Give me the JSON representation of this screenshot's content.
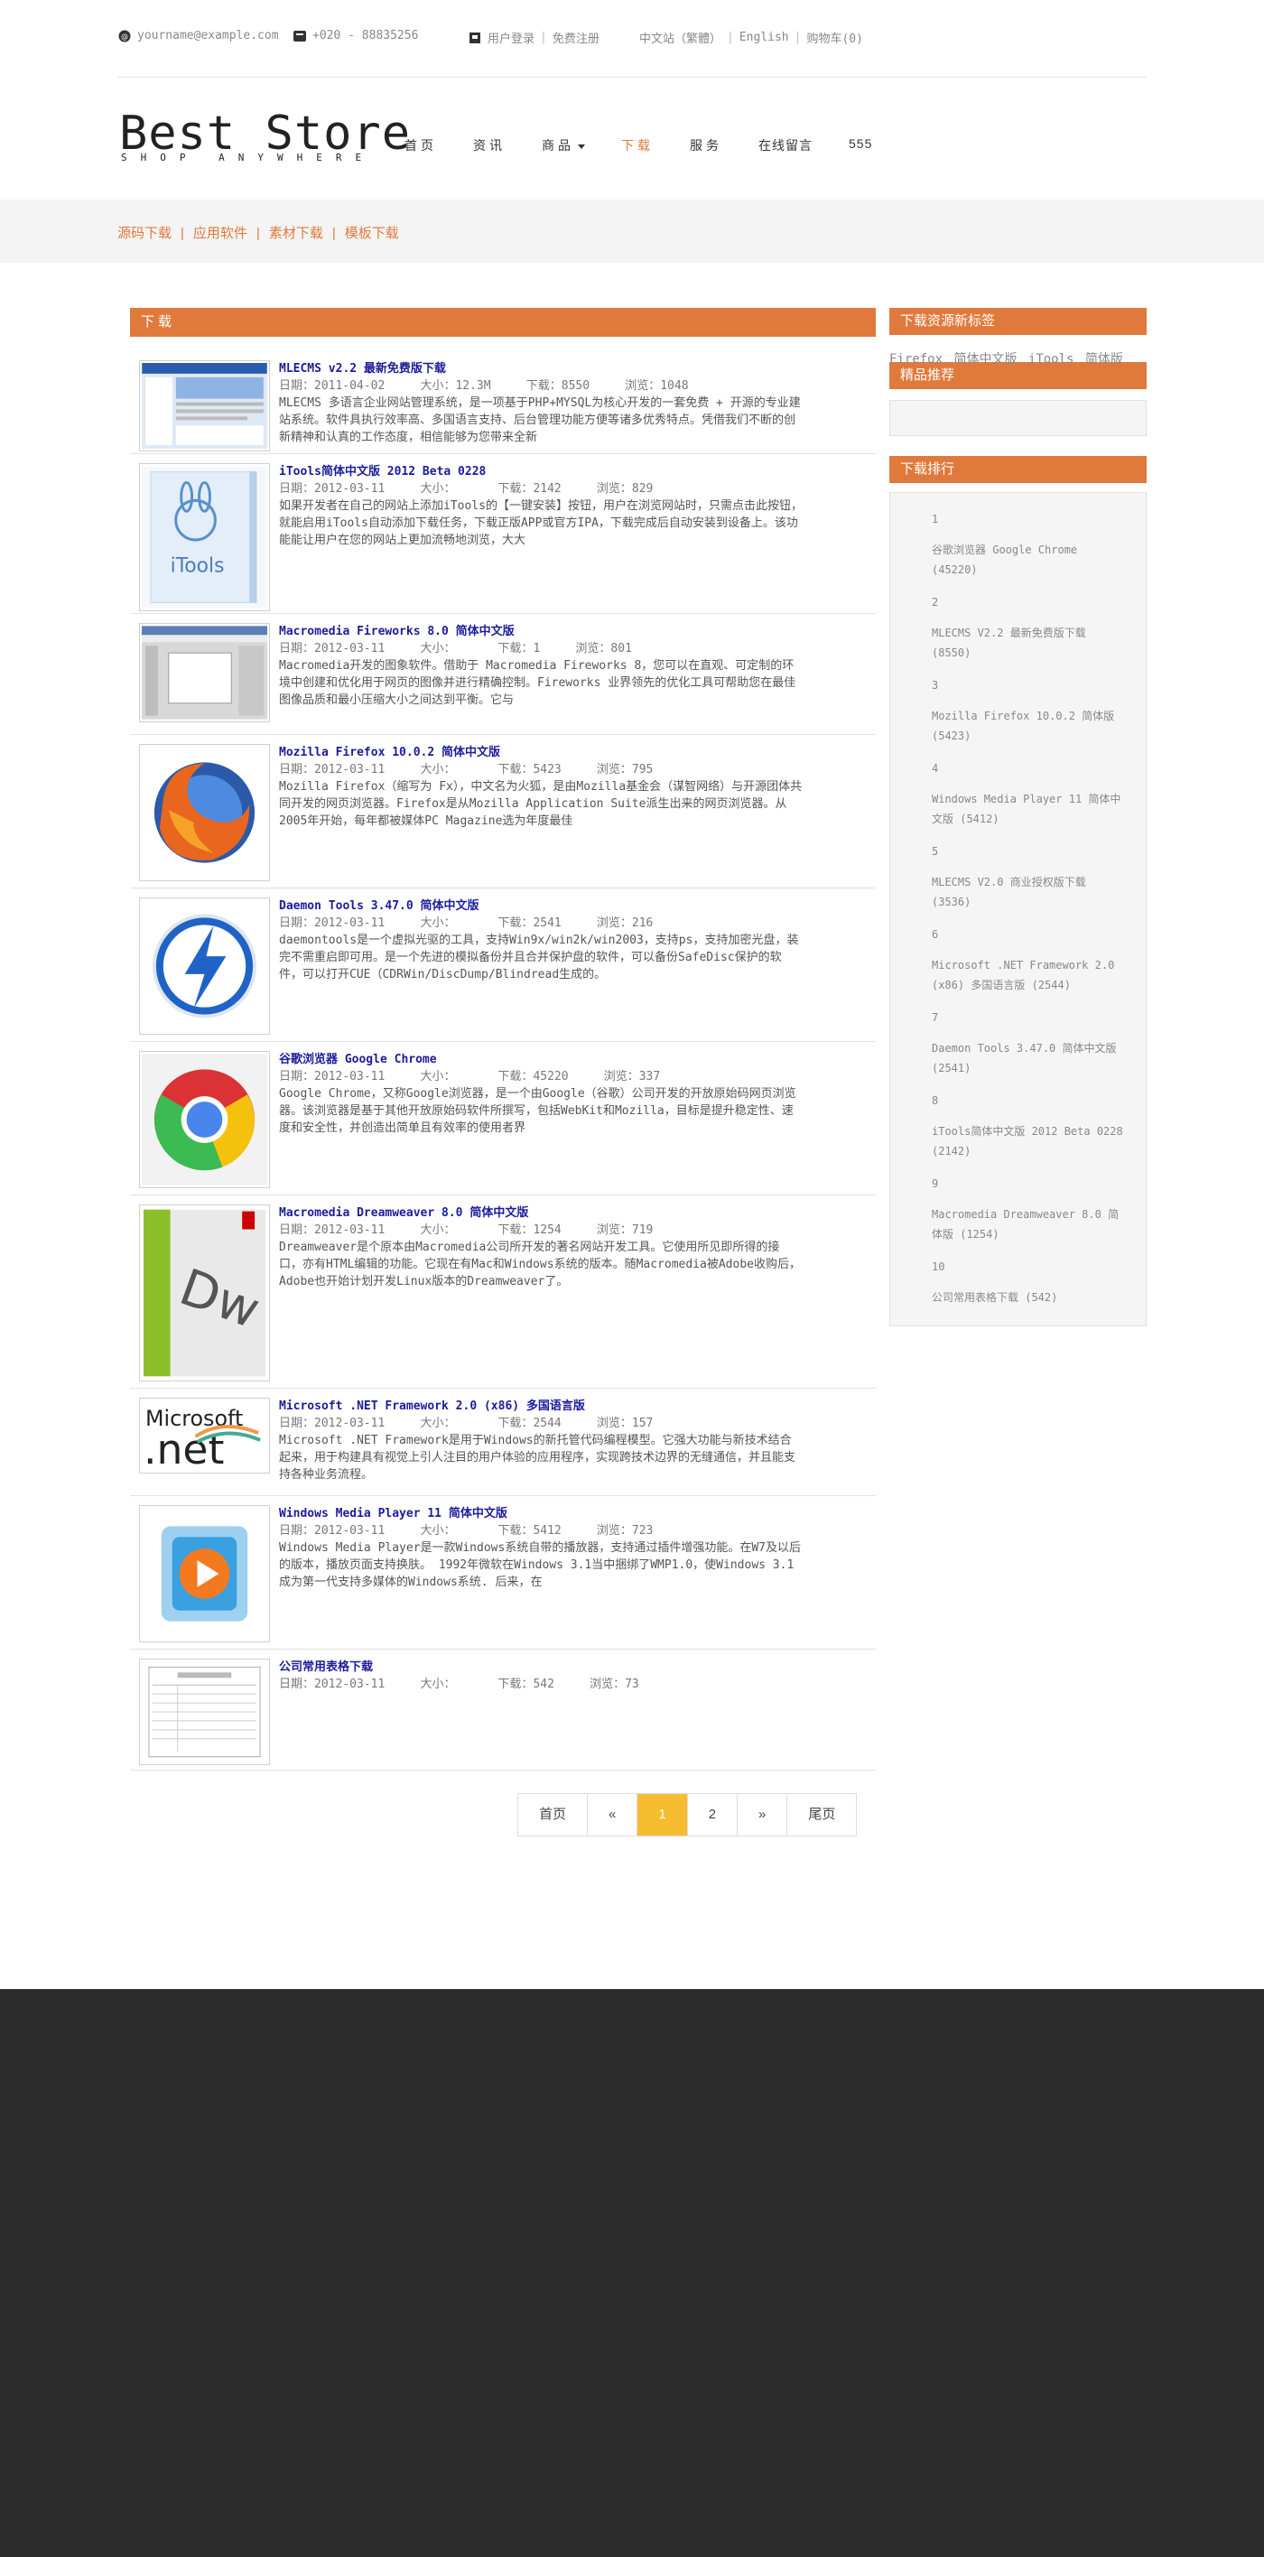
{
  "topbar": {
    "email": "yourname@example.com",
    "phone": "+020 - 88835256",
    "login": "用户登录",
    "register": "免费注册",
    "lang_cn": "中文站（繁體）",
    "lang_en": "English",
    "cart": "购物车(0)"
  },
  "logo": {
    "title": "Best Store",
    "subtitle": "SHOP ANYWHERE"
  },
  "nav": [
    "首页",
    "资讯",
    "商品",
    "下载",
    "服务",
    "在线留言",
    "555"
  ],
  "subnav": [
    "源码下载",
    "应用软件",
    "素材下载",
    "模板下载"
  ],
  "main_title": "下载",
  "downloads": [
    {
      "title": "MLECMS v2.2 最新免费版下载",
      "date": "2011-04-02",
      "size": "12.3M",
      "downloads": "8550",
      "views": "1048",
      "desc": "MLECMS 多语言企业网站管理系统，是一项基于PHP+MYSQL为核心开发的一套免费 + 开源的专业建站系统。软件具执行效率高、多国语言支持、后台管理功能方便等诸多优秀特点。凭借我们不断的创新精神和认真的工作态度，相信能够为您带来全新"
    },
    {
      "title": "iTools简体中文版 2012 Beta 0228",
      "date": "2012-03-11",
      "size": "",
      "downloads": "2142",
      "views": "829",
      "desc": "如果开发者在自己的网站上添加iTools的【一键安装】按钮，用户在浏览网站时，只需点击此按钮，就能启用iTools自动添加下载任务，下载正版APP或官方IPA，下载完成后自动安装到设备上。该功能能让用户在您的网站上更加流畅地浏览，大大"
    },
    {
      "title": "Macromedia Fireworks 8.0 简体中文版",
      "date": "2012-03-11",
      "size": "",
      "downloads": "1",
      "views": "801",
      "desc": "Macromedia开发的图象软件。借助于 Macromedia Fireworks 8，您可以在直观、可定制的环境中创建和优化用于网页的图像并进行精确控制。Fireworks 业界领先的优化工具可帮助您在最佳图像品质和最小压缩大小之间达到平衡。它与"
    },
    {
      "title": "Mozilla Firefox 10.0.2 简体中文版",
      "date": "2012-03-11",
      "size": "",
      "downloads": "5423",
      "views": "795",
      "desc": "Mozilla Firefox（缩写为 Fx），中文名为火狐，是由Mozilla基金会（谋智网络）与开源团体共同开发的网页浏览器。Firefox是从Mozilla Application Suite派生出来的网页浏览器。从2005年开始，每年都被媒体PC Magazine选为年度最佳"
    },
    {
      "title": "Daemon Tools 3.47.0 简体中文版",
      "date": "2012-03-11",
      "size": "",
      "downloads": "2541",
      "views": "216",
      "desc": "daemontools是一个虚拟光驱的工具，支持Win9x/win2k/win2003，支持ps，支持加密光盘，装完不需重启即可用。是一个先进的模拟备份并且合并保护盘的软件，可以备份SafeDisc保护的软件，可以打开CUE（CDRWin/DiscDump/Blindread生成的。"
    },
    {
      "title": "谷歌浏览器 Google Chrome",
      "date": "2012-03-11",
      "size": "",
      "downloads": "45220",
      "views": "337",
      "desc": "Google Chrome，又称Google浏览器，是一个由Google（谷歌）公司开发的开放原始码网页浏览器。该浏览器是基于其他开放原始码软件所撰写，包括WebKit和Mozilla，目标是提升稳定性、速度和安全性，并创造出简单且有效率的使用者界"
    },
    {
      "title": "Macromedia Dreamweaver 8.0 简体中文版",
      "date": "2012-03-11",
      "size": "",
      "downloads": "1254",
      "views": "719",
      "desc": "Dreamweaver是个原本由Macromedia公司所开发的著名网站开发工具。它使用所见即所得的接口，亦有HTML编辑的功能。它现在有Mac和Windows系统的版本。随Macromedia被Adobe收购后，Adobe也开始计划开发Linux版本的Dreamweaver了。"
    },
    {
      "title": "Microsoft .NET Framework 2.0 (x86) 多国语言版",
      "date": "2012-03-11",
      "size": "",
      "downloads": "2544",
      "views": "157",
      "desc": "Microsoft .NET Framework是用于Windows的新托管代码编程模型。它强大功能与新技术结合起来，用于构建具有视觉上引人注目的用户体验的应用程序，实现跨技术边界的无缝通信，并且能支持各种业务流程。"
    },
    {
      "title": "Windows Media Player 11 简体中文版",
      "date": "2012-03-11",
      "size": "",
      "downloads": "5412",
      "views": "723",
      "desc": "Windows Media Player是一款Windows系统自带的播放器，支持通过插件增强功能。在W7及以后的版本，播放页面支持换肤。 1992年微软在Windows 3.1当中捆绑了WMP1.0，使Windows 3.1成为第一代支持多媒体的Windows系统. 后来，在"
    },
    {
      "title": "公司常用表格下载",
      "date": "2012-03-11",
      "size": "",
      "downloads": "542",
      "views": "73",
      "desc": ""
    }
  ],
  "labels": {
    "date": "日期：",
    "size": "大小：",
    "downloads": "下载：",
    "views": "浏览："
  },
  "pager": [
    "首页",
    "«",
    "1",
    "2",
    "»",
    "尾页"
  ],
  "sidebar": {
    "tags_title": "下载资源新标签",
    "tags": [
      "Firefox",
      "简体中文版",
      "iTools",
      "简体版"
    ],
    "recommend_title": "精品推荐",
    "rank_title": "下载排行",
    "rank": [
      {
        "num": "1",
        "text": "谷歌浏览器 Google Chrome (45220)"
      },
      {
        "num": "2",
        "text": "MLECMS V2.2 最新免费版下载 (8550)"
      },
      {
        "num": "3",
        "text": "Mozilla Firefox 10.0.2 简体版 (5423)"
      },
      {
        "num": "4",
        "text": "Windows Media Player 11 简体中文版 (5412)"
      },
      {
        "num": "5",
        "text": "MLECMS V2.0 商业授权版下载 (3536)"
      },
      {
        "num": "6",
        "text": "Microsoft .NET Framework 2.0 (x86) 多国语言版 (2544)"
      },
      {
        "num": "7",
        "text": "Daemon Tools 3.47.0 简体中文版 (2541)"
      },
      {
        "num": "8",
        "text": "iTools简体中文版 2012 Beta 0228 (2142)"
      },
      {
        "num": "9",
        "text": "Macromedia Dreamweaver 8.0 简体版 (1254)"
      },
      {
        "num": "10",
        "text": "公司常用表格下载 (542)"
      }
    ]
  },
  "colors": {
    "accent": "#e07a3c",
    "pager_active": "#f7bd31",
    "footer": "#2c2c2d"
  }
}
